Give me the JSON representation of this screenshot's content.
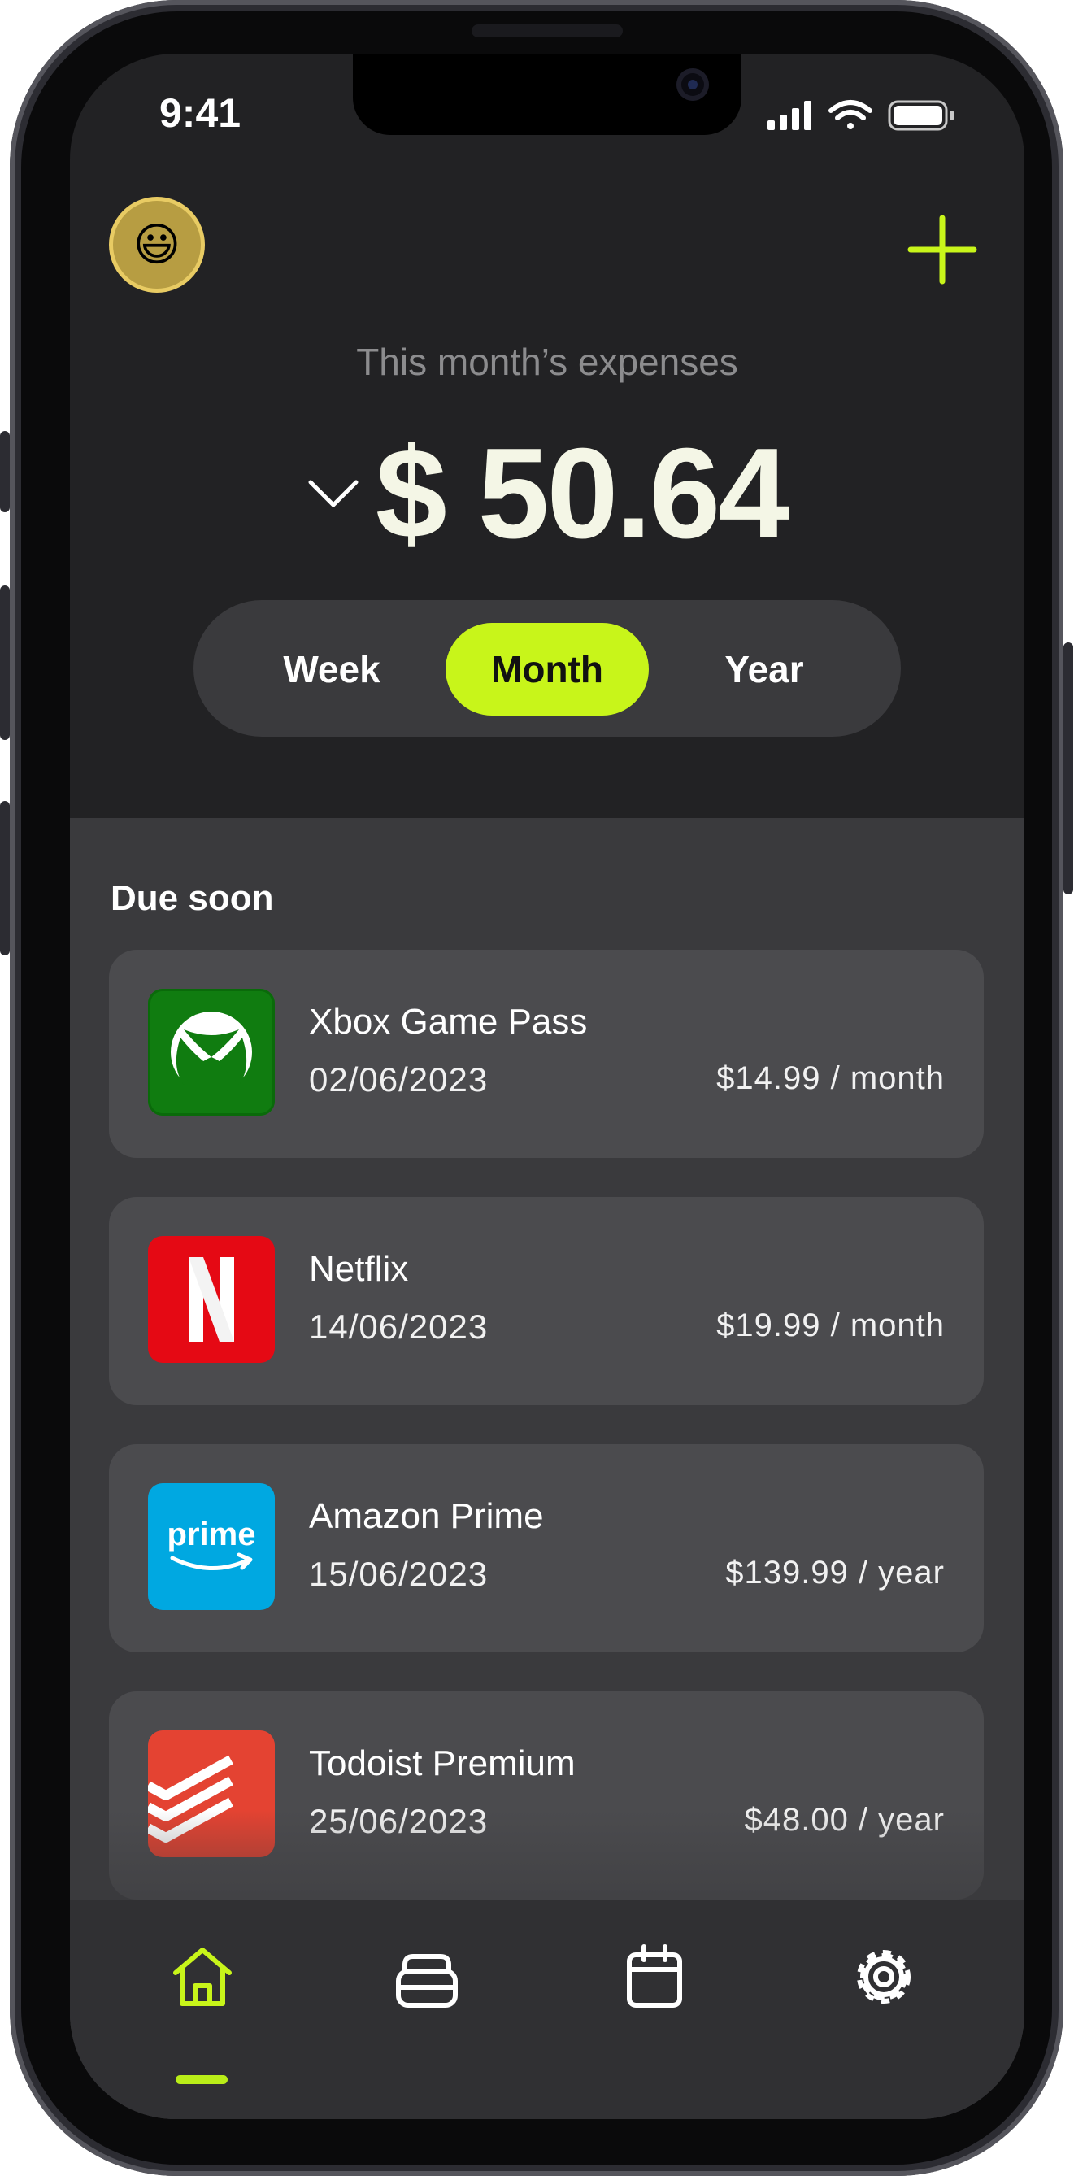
{
  "status_bar": {
    "time": "9:41"
  },
  "header": {
    "avatar_emoji": "😃",
    "subtitle": "This month’s expenses",
    "amount": "$ 50.64"
  },
  "period_switch": {
    "options": [
      "Week",
      "Month",
      "Year"
    ],
    "selected": "Month"
  },
  "due_soon": {
    "title": "Due soon",
    "items": [
      {
        "name": "Xbox Game Pass",
        "date": "02/06/2023",
        "price": "$14.99 / month",
        "icon": "xbox-icon"
      },
      {
        "name": "Netflix",
        "date": "14/06/2023",
        "price": "$19.99 / month",
        "icon": "netflix-icon"
      },
      {
        "name": "Amazon Prime",
        "date": "15/06/2023",
        "price": "$139.99 / year",
        "icon": "prime-icon",
        "logo_text": "prime"
      },
      {
        "name": "Todoist Premium",
        "date": "25/06/2023",
        "price": "$48.00 / year",
        "icon": "todoist-icon"
      }
    ]
  },
  "tab_bar": {
    "items": [
      "home-icon",
      "wallet-icon",
      "calendar-icon",
      "settings-icon"
    ],
    "active": "home-icon"
  },
  "colors": {
    "accent": "#c8f51a",
    "background": "#222224",
    "panel": "#3a3a3d",
    "card": "#4b4b4e"
  }
}
